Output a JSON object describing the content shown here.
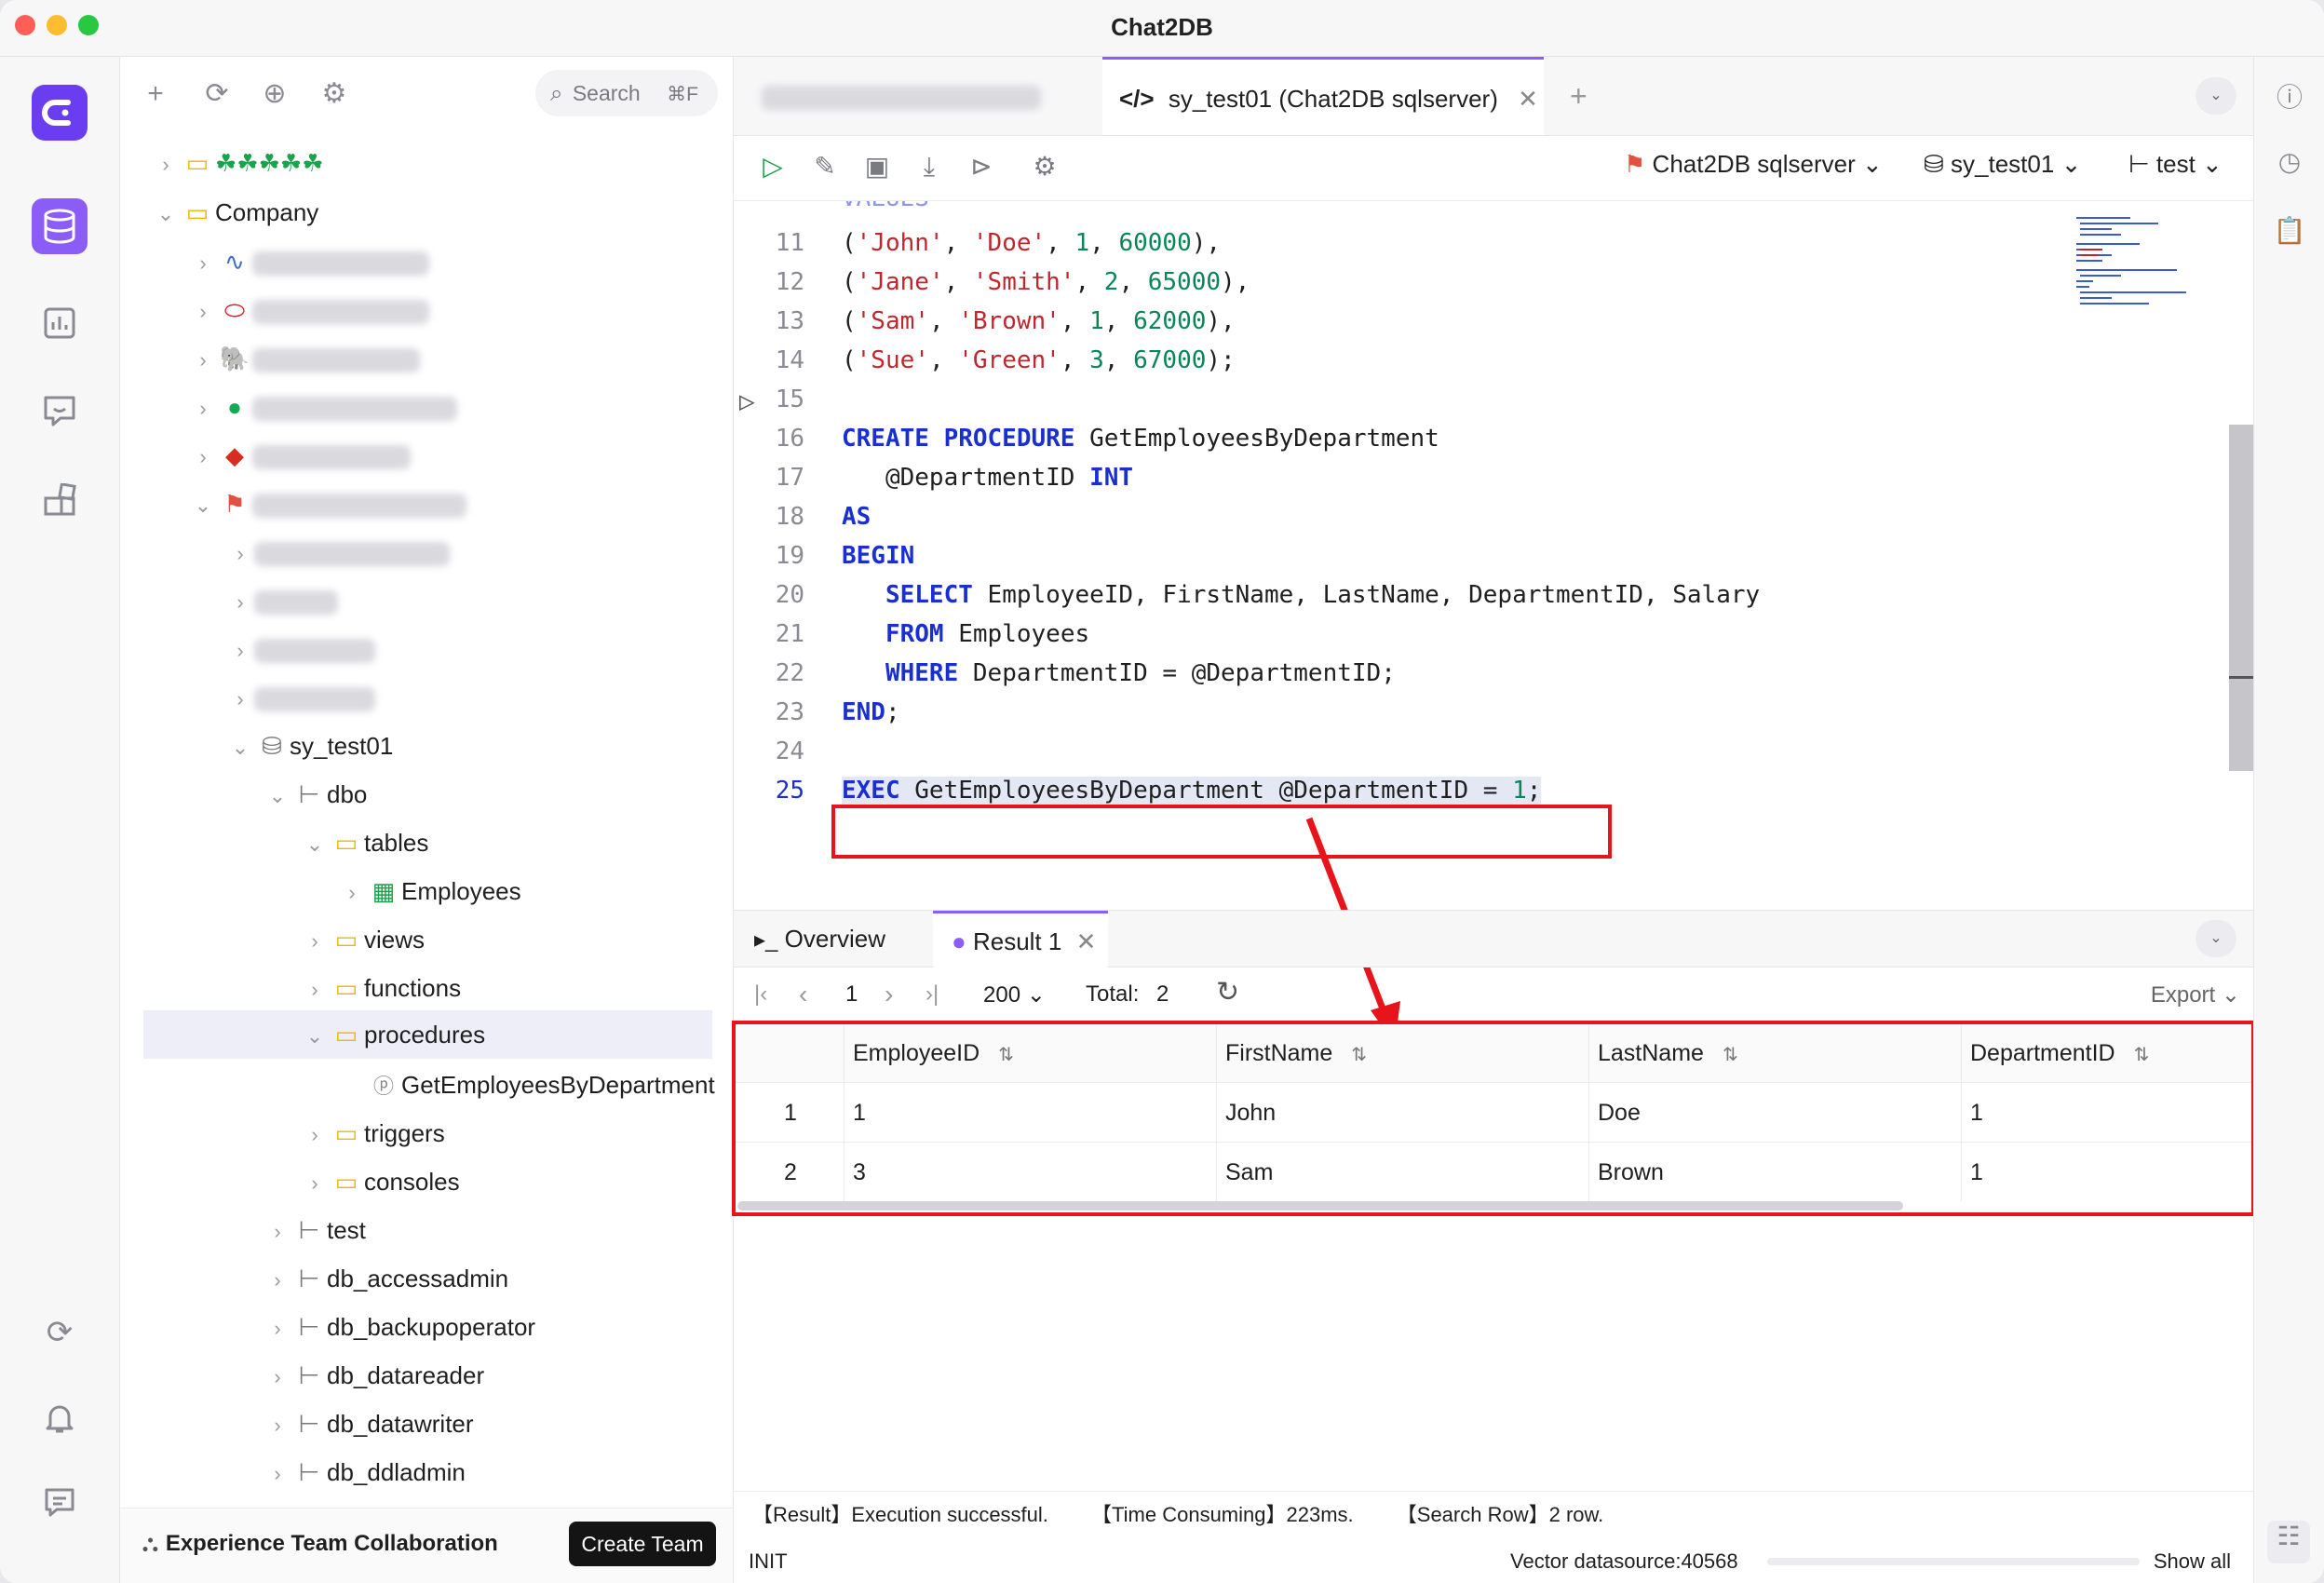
{
  "window": {
    "title": "Chat2DB"
  },
  "colors": {
    "accent": "#8b5cf6",
    "keyword": "#1a2fd0",
    "string": "#c0262d",
    "number": "#098658",
    "highlight": "#e8141c",
    "pink_logo": "#e8368f"
  },
  "rail": {
    "icons": [
      "app-logo-icon",
      "database-icon",
      "dashboard-icon",
      "chat-bot-icon",
      "plugins-icon",
      "sync-icon",
      "bell-icon",
      "feedback-icon"
    ]
  },
  "tree": {
    "search_placeholder": "Search",
    "search_shortcut": "⌘F",
    "root1": "☘☘☘☘☘",
    "company": "Company",
    "database": "sy_test01",
    "schema": "dbo",
    "tables": "tables",
    "employees": "Employees",
    "views": "views",
    "functions": "functions",
    "procedures": "procedures",
    "procedure_item": "GetEmployeesByDepartment",
    "triggers": "triggers",
    "consoles": "consoles",
    "schemas": [
      "test",
      "db_accessadmin",
      "db_backupoperator",
      "db_datareader",
      "db_datawriter",
      "db_ddladmin"
    ],
    "team_text": "Experience Team Collaboration",
    "team_button": "Create Team"
  },
  "tabs": {
    "active": "sy_test01 (Chat2DB sqlserver)"
  },
  "editor_toolbar": {
    "datasource": "Chat2DB sqlserver",
    "database": "sy_test01",
    "schema": "test"
  },
  "editor": {
    "line_numbers": [
      "11",
      "12",
      "13",
      "14",
      "15",
      "16",
      "17",
      "18",
      "19",
      "20",
      "21",
      "22",
      "23",
      "24",
      "25"
    ]
  },
  "results": {
    "tab_overview": "Overview",
    "tab_result": "Result 1",
    "page": "1",
    "page_size": "200",
    "total_label": "Total:",
    "total_value": "2",
    "export": "Export",
    "columns": [
      "EmployeeID",
      "FirstName",
      "LastName",
      "DepartmentID"
    ],
    "rows": [
      {
        "index": "1",
        "cells": [
          "1",
          "John",
          "Doe",
          "1"
        ]
      },
      {
        "index": "2",
        "cells": [
          "3",
          "Sam",
          "Brown",
          "1"
        ]
      }
    ],
    "status_result": "【Result】Execution successful.",
    "status_time": "【Time Consuming】223ms.",
    "status_rows": "【Search Row】2 row.",
    "footer_left": "INIT",
    "footer_vector": "Vector datasource:40568",
    "footer_show_all": "Show all"
  }
}
